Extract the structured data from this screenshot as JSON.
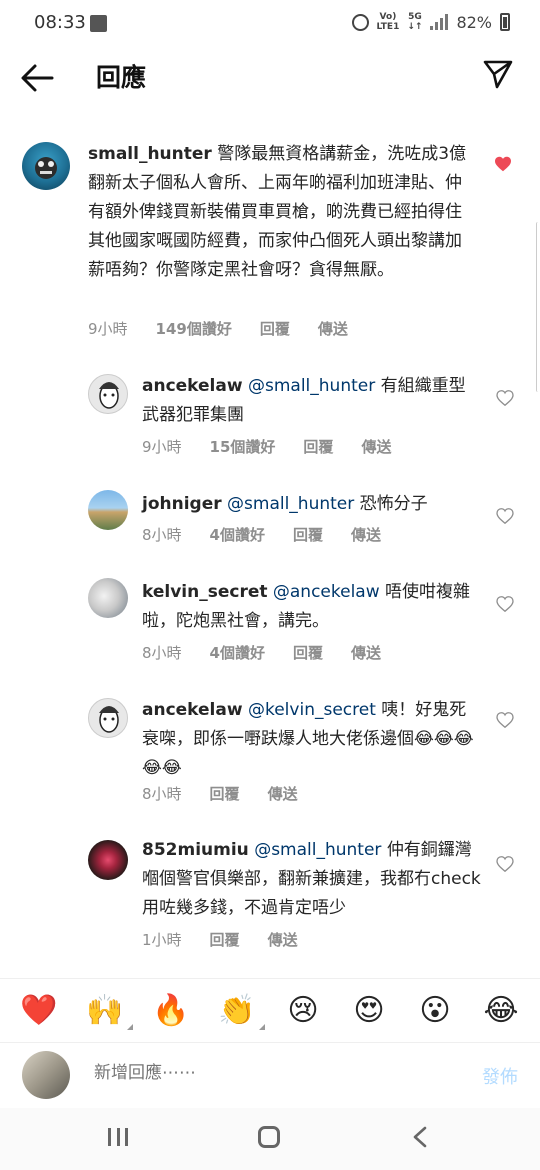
{
  "status_bar": {
    "time": "08:33",
    "network_top": "Vo)",
    "network_bottom": "LTE1",
    "five_g_top": "5G",
    "five_g_bottom": "↓↑",
    "battery": "82%"
  },
  "header": {
    "title": "回應"
  },
  "comments": [
    {
      "username": "small_hunter",
      "mention": "",
      "text": "警隊最無資格講薪金，洗咗成3億翻新太子個私人會所、上兩年啲福利加班津貼、仲有額外俾錢買新裝備買車買槍，啲洗費已經拍得住其他國家嘅國防經費，而家仲凸個死人頭出黎講加薪唔夠？你警隊定黑社會呀？貪得無厭。",
      "time": "9小時",
      "likes": "149個讚好",
      "reply": "回覆",
      "send": "傳送",
      "liked": true
    },
    {
      "username": "ancekelaw",
      "mention": "@small_hunter",
      "text": "有組織重型武器犯罪集團",
      "time": "9小時",
      "likes": "15個讚好",
      "reply": "回覆",
      "send": "傳送",
      "liked": false
    },
    {
      "username": "johniger",
      "mention": "@small_hunter",
      "text": "恐怖分子",
      "time": "8小時",
      "likes": "4個讚好",
      "reply": "回覆",
      "send": "傳送",
      "liked": false
    },
    {
      "username": "kelvin_secret",
      "mention": "@ancekelaw",
      "text": "唔使咁複雜啦，陀炮黑社會，講完。",
      "time": "8小時",
      "likes": "4個讚好",
      "reply": "回覆",
      "send": "傳送",
      "liked": false
    },
    {
      "username": "ancekelaw",
      "mention": "@kelvin_secret",
      "text": "咦！好鬼死衰㗎，即係一嘢趺爆人地大佬係邊個😂😂😂😂😂",
      "time": "8小時",
      "likes": "",
      "reply": "回覆",
      "send": "傳送",
      "liked": false
    },
    {
      "username": "852miumiu",
      "mention": "@small_hunter",
      "text": "仲有銅鑼灣嗰個警官俱樂部，翻新兼擴建，我都冇check用咗幾多錢，不過肯定唔少",
      "time": "1小時",
      "likes": "",
      "reply": "回覆",
      "send": "傳送",
      "liked": false
    }
  ],
  "emoji_bar": [
    "❤️",
    "🙌",
    "🔥",
    "👏",
    "😢",
    "😍",
    "😮",
    "😂"
  ],
  "input": {
    "placeholder": "新增回應⋯⋯",
    "post_label": "發佈"
  },
  "colors": {
    "liked_heart": "#ed4956",
    "mention": "#00376b",
    "meta": "#8e8e8e",
    "post_button": "#b3dbff"
  }
}
